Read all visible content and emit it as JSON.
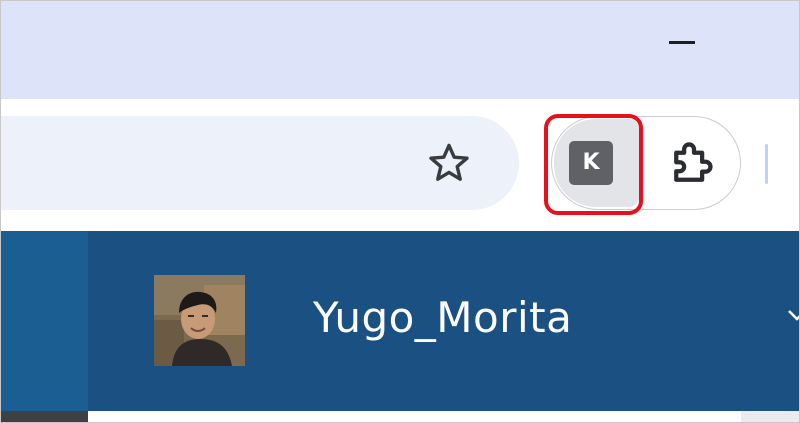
{
  "window": {
    "minimize_icon": "minimize-icon"
  },
  "toolbar": {
    "bookmark_icon": "star-outline-icon",
    "extension_k": {
      "label": "K",
      "icon": "k-extension-icon",
      "highlight_color": "#e8101a"
    },
    "extensions_icon": "puzzle-piece-icon"
  },
  "profile": {
    "username": "Yugo_Morita",
    "avatar": "user-avatar-photo",
    "dropdown_icon": "chevron-down-icon"
  },
  "colors": {
    "titlebar": "#dde3f8",
    "omnibox": "#edf1fa",
    "header_bg": "#1b5182",
    "sidebar_bg": "#1a5e92"
  }
}
